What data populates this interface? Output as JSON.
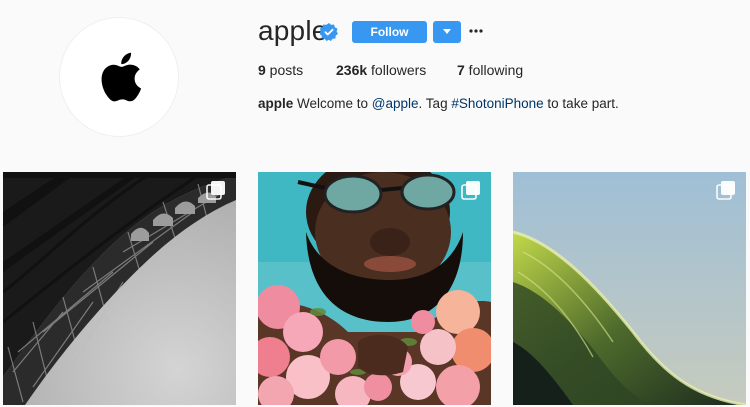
{
  "profile": {
    "username": "apple",
    "verified": true,
    "follow_label": "Follow",
    "dropdown_icon": "chevron-down-icon",
    "more_icon": "more-options-icon",
    "avatar_icon": "apple-logo-icon"
  },
  "stats": {
    "posts_count": "9",
    "posts_label": " posts",
    "followers_count": "236k",
    "followers_label": " followers",
    "following_count": "7",
    "following_label": " following"
  },
  "bio": {
    "name": "apple",
    "text_1": " Welcome to ",
    "mention": "@apple",
    "text_2": ". Tag ",
    "hashtag": "#ShotoniPhone",
    "text_3": " to take part."
  },
  "posts": [
    {
      "subject": "eiffel-tower",
      "multi_icon": "carousel-icon"
    },
    {
      "subject": "portrait-with-flowers",
      "multi_icon": "carousel-icon"
    },
    {
      "subject": "ocean-wave",
      "multi_icon": "carousel-icon"
    }
  ],
  "colors": {
    "accent": "#3897f0",
    "link": "#003569",
    "text": "#262626",
    "background": "#fafafa"
  }
}
